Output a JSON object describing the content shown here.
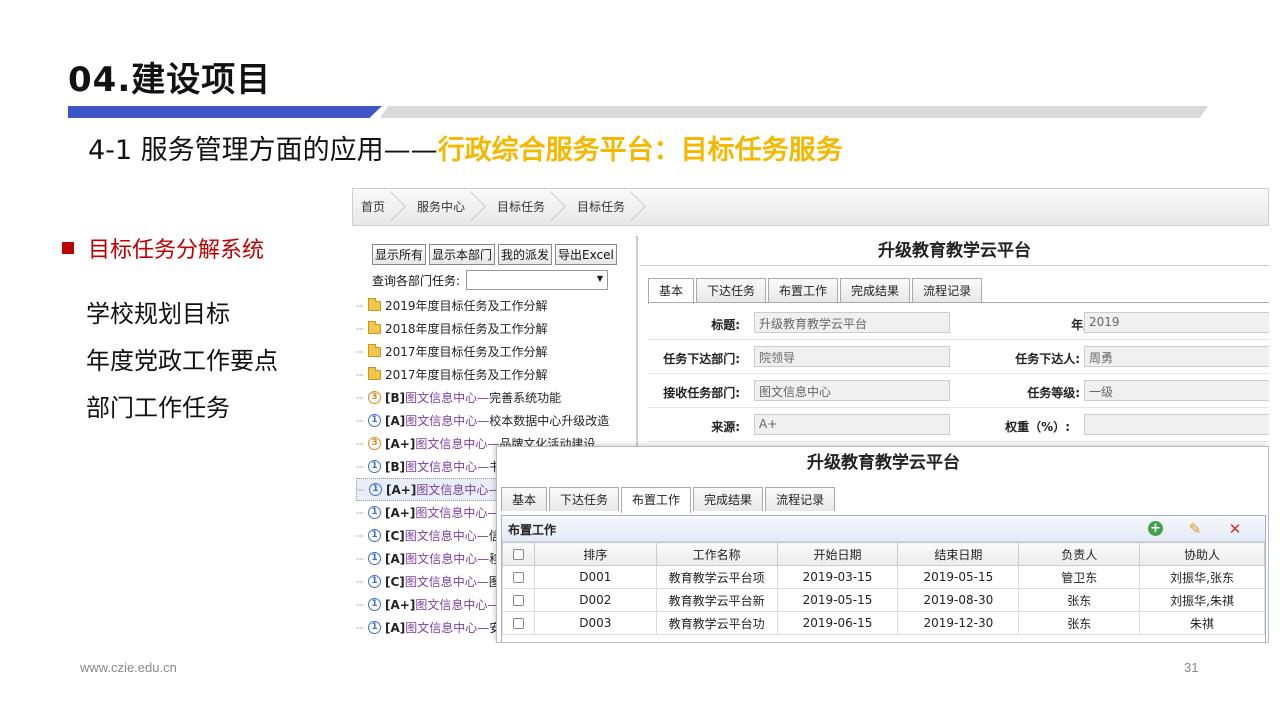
{
  "slide": {
    "title": "04.建设项目",
    "subtitle_prefix": "4-1 服务管理方面的应用——",
    "subtitle_highlight": "行政综合服务平台：目标任务服务",
    "bullet_heading": "目标任务分解系统",
    "sub_items": [
      "学校规划目标",
      "年度党政工作要点",
      "部门工作任务"
    ],
    "footer_url": "www.czie.edu.cn",
    "page_number": "31",
    "colors": {
      "accent_blue": "#3d57c9",
      "highlight_yellow": "#f5b800",
      "bullet_red": "#c00000"
    }
  },
  "app": {
    "breadcrumbs": [
      "首页",
      "服务中心",
      "目标任务",
      "目标任务"
    ],
    "toolbar_buttons": [
      "显示所有",
      "显示本部门",
      "我的派发",
      "导出Excel"
    ],
    "query_label": "查询各部门任务:",
    "tree": {
      "folders": [
        "2019年度目标任务及工作分解",
        "2018年度目标任务及工作分解",
        "2017年度目标任务及工作分解",
        "2017年度目标任务及工作分解"
      ],
      "tasks": [
        {
          "tag": "[B]",
          "dept": "图文信息中心—",
          "name": "完善系统功能",
          "icon": "status-3-icon"
        },
        {
          "tag": "[A]",
          "dept": "图文信息中心—",
          "name": "校本数据中心升级改造",
          "icon": "status-1-icon"
        },
        {
          "tag": "[A+]",
          "dept": "图文信息中心—",
          "name": "品牌文化活动建设",
          "icon": "status-3-icon"
        },
        {
          "tag": "[B]",
          "dept": "图文信息中心—",
          "name": "书香",
          "icon": "status-1-icon"
        },
        {
          "tag": "[A+]",
          "dept": "图文信息中心—",
          "name": "升",
          "icon": "status-1-icon"
        },
        {
          "tag": "[A+]",
          "dept": "图文信息中心—",
          "name": "输",
          "icon": "status-1-icon"
        },
        {
          "tag": "[C]",
          "dept": "图文信息中心—",
          "name": "信息",
          "icon": "status-1-icon"
        },
        {
          "tag": "[A]",
          "dept": "图文信息中心—",
          "name": "移动",
          "icon": "status-1-icon"
        },
        {
          "tag": "[C]",
          "dept": "图文信息中心—",
          "name": "图文",
          "icon": "status-1-icon"
        },
        {
          "tag": "[A+]",
          "dept": "图文信息中心—",
          "name": "升",
          "icon": "status-1-icon"
        },
        {
          "tag": "[A]",
          "dept": "图文信息中心—",
          "name": "安全",
          "icon": "status-1-icon"
        }
      ]
    },
    "detail": {
      "title": "升级教育教学云平台",
      "tabs": [
        "基本",
        "下达任务",
        "布置工作",
        "完成结果",
        "流程记录"
      ],
      "fields": {
        "title_label": "标题:",
        "title_value": "升级教育教学云平台",
        "year_label": "年度:",
        "year_value": "2019",
        "issuing_dept_label": "任务下达部门:",
        "issuing_dept_value": "院领导",
        "issuer_label": "任务下达人:",
        "issuer_value": "周勇",
        "receiving_dept_label": "接收任务部门:",
        "receiving_dept_value": "图文信息中心",
        "level_label": "任务等级:",
        "level_value": "一级",
        "source_label": "来源:",
        "source_value": "A+",
        "weight_label": "权重（%）:",
        "weight_value": ""
      }
    },
    "overlay": {
      "title": "升级教育教学云平台",
      "tabs": [
        "基本",
        "下达任务",
        "布置工作",
        "完成结果",
        "流程记录"
      ],
      "panel_title": "布置工作",
      "columns": [
        "排序",
        "工作名称",
        "开始日期",
        "结束日期",
        "负责人",
        "协助人"
      ],
      "rows": [
        [
          "D001",
          "教育教学云平台项",
          "2019-03-15",
          "2019-05-15",
          "管卫东",
          "刘振华,张东"
        ],
        [
          "D002",
          "教育教学云平台新",
          "2019-05-15",
          "2019-08-30",
          "张东",
          "刘振华,朱祺"
        ],
        [
          "D003",
          "教育教学云平台功",
          "2019-06-15",
          "2019-12-30",
          "张东",
          "朱祺"
        ]
      ]
    }
  }
}
